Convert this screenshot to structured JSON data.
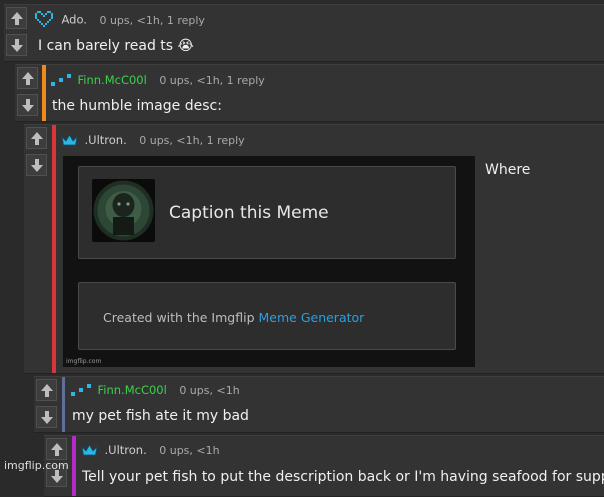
{
  "comments": [
    {
      "user": "Ado.",
      "user_color": "#cfcfcf",
      "accent": "",
      "meta": "0 ups, <1h, 1 reply",
      "text": "I can barely read ts 😭",
      "avatar": "pixel-heart-icon"
    },
    {
      "user": "Finn.McC00l",
      "user_color": "#3bd14a",
      "accent": "#f08a1c",
      "meta": "0 ups, <1h, 1 reply",
      "text": "the humble image desc:",
      "avatar": "pixel-dots-icon"
    },
    {
      "user": ".Ultron.",
      "user_color": "#cfcfcf",
      "accent": "#d9353b",
      "meta": "0 ups, <1h, 1 reply",
      "text": "Where",
      "avatar": "crown-icon",
      "embed": {
        "caption_title": "Caption this Meme",
        "created_prefix": "Created with the Imgflip",
        "created_link": "Meme Generator",
        "site": "imgflip.com"
      }
    },
    {
      "user": "Finn.McC00l",
      "user_color": "#3bd14a",
      "accent": "#5f6f9a",
      "meta": "0 ups, <1h",
      "text": "my pet fish ate it my bad",
      "avatar": "pixel-dots-icon"
    },
    {
      "user": ".Ultron.",
      "user_color": "#cfcfcf",
      "accent": "#b42bc8",
      "meta": "0 ups, <1h",
      "text": "Tell your pet fish to put the description back or I'm having seafood for supper",
      "avatar": "crown-icon"
    }
  ],
  "watermark": "imgflip.com",
  "colors": {
    "link": "#2a9fe0",
    "bg": "#2a2a2a",
    "card": "#333333"
  }
}
